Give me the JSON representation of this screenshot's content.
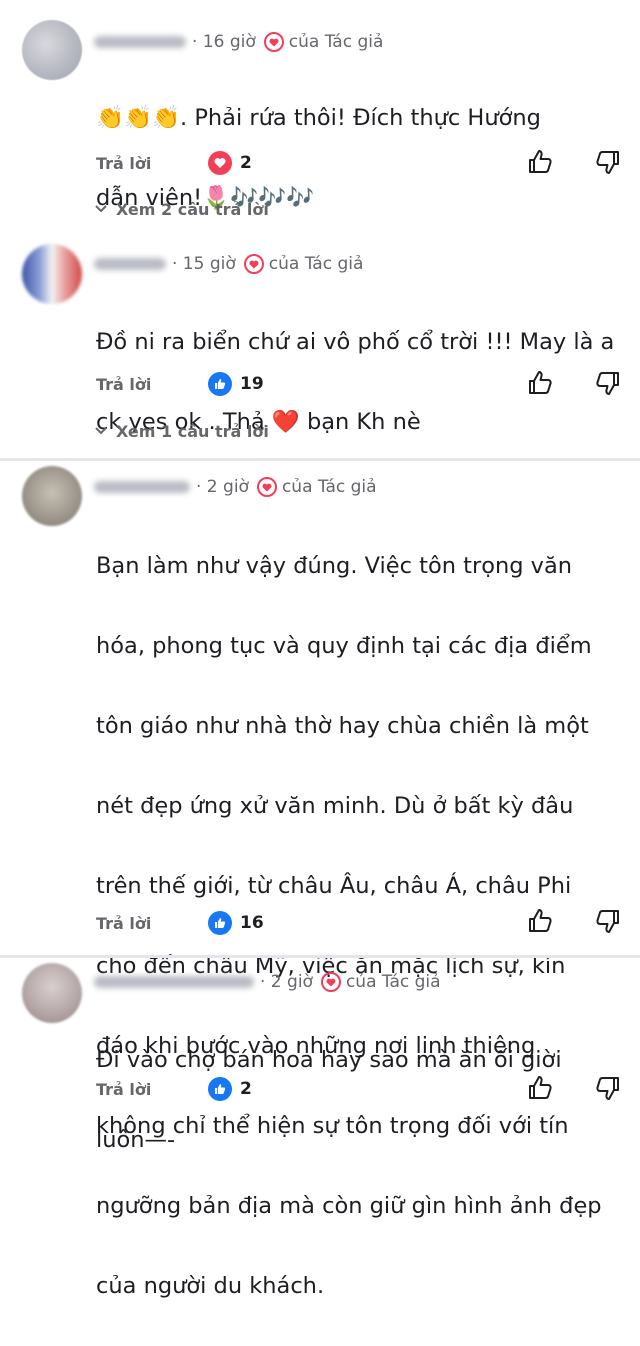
{
  "colors": {
    "like": "#1877f2",
    "heart": "#f33e58",
    "muted": "#65676b",
    "divider": "#e4e6eb"
  },
  "comments": [
    {
      "time": "· 16 giờ",
      "author_badge": "của Tác giả",
      "text_line1": "👏👏👏. Phải rứa thôi! Đích thực Hướng",
      "text_line2": "dẫn viên!🌷🎶🎶🎶",
      "reply": "Trả lời",
      "reaction_icon": "heart-icon",
      "reaction_count": "2",
      "view_replies": "Xem 2 câu trả lời"
    },
    {
      "time": "· 15 giờ",
      "author_badge": "của Tác giả",
      "text_line1": "Đồ ni ra biển chứ ai vô phố cổ trời !!! May là a",
      "text_line2": "ck yes ok . Thả ❤️ bạn Kh nè",
      "reply": "Trả lời",
      "reaction_icon": "like-icon",
      "reaction_count": "19",
      "view_replies": "Xem 1 câu trả lời"
    },
    {
      "time": "· 2 giờ",
      "author_badge": "của Tác giả",
      "lines": [
        "Bạn làm như vậy đúng. Việc tôn trọng văn",
        "hóa, phong tục và quy định tại các địa điểm",
        "tôn giáo như nhà thờ hay chùa chiền là một",
        "nét đẹp ứng xử văn minh. Dù ở bất kỳ đâu",
        "trên thế giới, từ châu Âu, châu Á, châu Phi",
        "cho đến châu Mỹ, việc ăn mặc lịch sự, kín",
        "đáo khi bước vào những nơi linh thiêng",
        "không chỉ thể hiện sự tôn trọng đối với tín",
        "ngưỡng bản địa mà còn giữ gìn hình ảnh đẹp",
        "của người du khách."
      ],
      "reply": "Trả lời",
      "reaction_icon": "like-icon",
      "reaction_count": "16"
    },
    {
      "time": "· 2 giờ",
      "author_badge": "của Tác giả",
      "text_line1": "Đi vào chợ bán hoa hay sao mà ăn ối giời",
      "text_line2": "luôn—-",
      "reply": "Trả lời",
      "reaction_icon": "like-icon",
      "reaction_count": "2"
    }
  ]
}
